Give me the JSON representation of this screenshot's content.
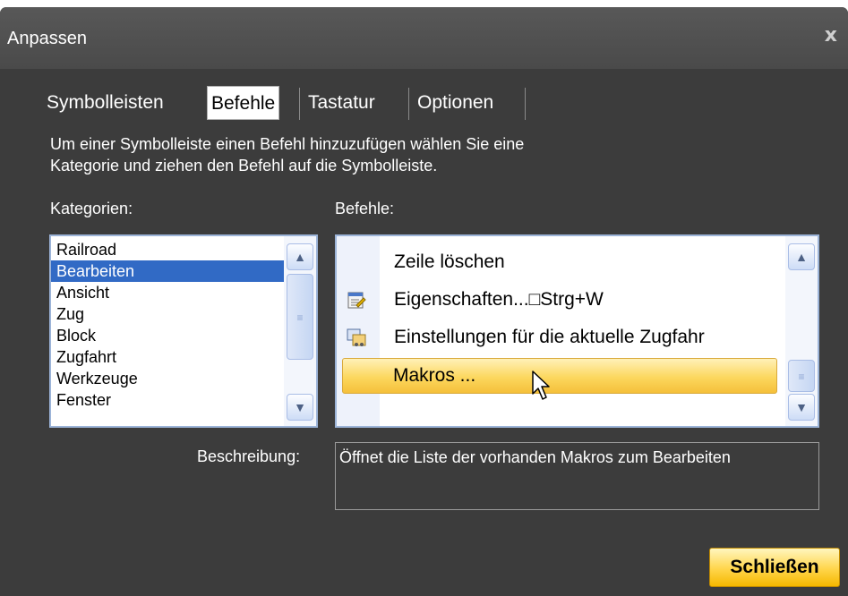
{
  "dialog": {
    "title": "Anpassen",
    "close_glyph": "x"
  },
  "tabs": [
    {
      "label": "Symbolleisten",
      "active": false
    },
    {
      "label": "Befehle",
      "active": true
    },
    {
      "label": "Tastatur",
      "active": false
    },
    {
      "label": "Optionen",
      "active": false
    }
  ],
  "instructions": {
    "line1": "Um einer Symbolleiste einen Befehl hinzuzufügen wählen Sie eine",
    "line2": "Kategorie und ziehen den Befehl auf die Symbolleiste."
  },
  "categories": {
    "label": "Kategorien:",
    "items": [
      "Railroad",
      "Bearbeiten",
      "Ansicht",
      "Zug",
      "Block",
      "Zugfahrt",
      "Werkzeuge",
      "Fenster"
    ],
    "selected": "Bearbeiten"
  },
  "commands": {
    "label": "Befehle:",
    "items": [
      {
        "label": "Zeile löschen",
        "icon": "none"
      },
      {
        "label": "Eigenschaften...□Strg+W",
        "icon": "properties-icon"
      },
      {
        "label": "Einstellungen für die aktuelle Zugfahr",
        "icon": "train-settings-icon"
      },
      {
        "label": "Makros ...",
        "icon": "none",
        "highlighted": true
      }
    ]
  },
  "description": {
    "label": "Beschreibung:",
    "text": "Öffnet die Liste der vorhanden Makros zum Bearbeiten"
  },
  "buttons": {
    "close_label": "Schließen"
  },
  "colors": {
    "dialog_bg": "#3c3c3c",
    "selection": "#316ac5",
    "highlight": "#fcd75e",
    "button_accent": "#ffd54a"
  }
}
